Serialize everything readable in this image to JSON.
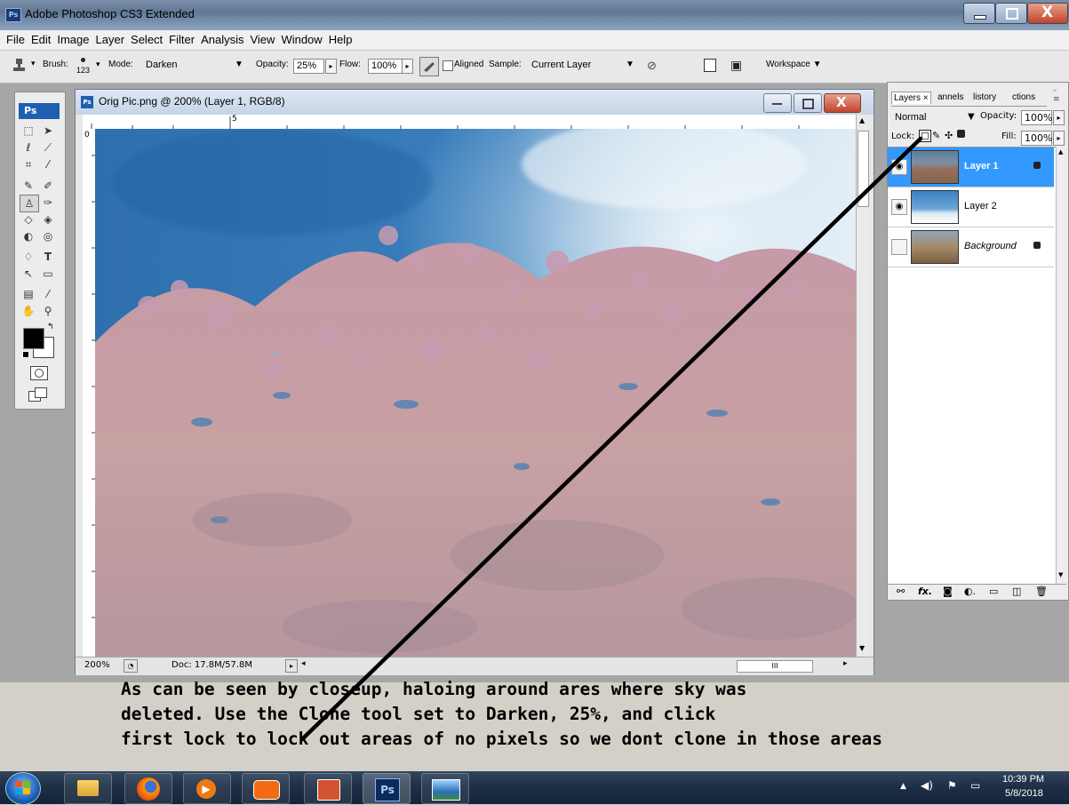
{
  "app": {
    "title": "Adobe Photoshop CS3 Extended",
    "badge": "Ps"
  },
  "menu": [
    "File",
    "Edit",
    "Image",
    "Layer",
    "Select",
    "Filter",
    "Analysis",
    "View",
    "Window",
    "Help"
  ],
  "options": {
    "brush_label": "Brush:",
    "brush_size": "123",
    "mode_label": "Mode:",
    "mode_value": "Darken",
    "opacity_label": "Opacity:",
    "opacity_value": "25%",
    "flow_label": "Flow:",
    "flow_value": "100%",
    "aligned_label": "Aligned",
    "sample_label": "Sample:",
    "sample_value": "Current Layer",
    "workspace_label": "Workspace"
  },
  "toolbox": {
    "logo": "Ps"
  },
  "document": {
    "title": "Orig Pic.png @ 200% (Layer 1, RGB/8)",
    "ruler_top_label": "5",
    "ruler_left_label": "0",
    "zoom": "200%",
    "doc_size": "Doc: 17.8M/57.8M",
    "scroll_marker": "III"
  },
  "layers_panel": {
    "tabs": [
      "Layers ×",
      "annels",
      "listory",
      "ctions"
    ],
    "blend_mode": "Normal",
    "opacity_label": "Opacity:",
    "opacity_value": "100%",
    "lock_label": "Lock:",
    "fill_label": "Fill:",
    "fill_value": "100%",
    "layers": [
      {
        "name": "Layer 1",
        "visible": true,
        "locked": true,
        "selected": true
      },
      {
        "name": "Layer 2",
        "visible": true,
        "locked": false,
        "selected": false
      },
      {
        "name": "Background",
        "visible": false,
        "locked": true,
        "selected": false
      }
    ],
    "footer_icons": [
      "link-icon",
      "fx-icon",
      "mask-icon",
      "adjustment-icon",
      "group-icon",
      "new-layer-icon",
      "trash-icon"
    ]
  },
  "annotation": {
    "line1": "As can be seen by closeup, haloing around ares where sky was",
    "line2": "deleted.  Use the Clone tool set to Darken, 25%,  and click",
    "line3": "first lock to lock out areas of no pixels so we dont clone in those areas"
  },
  "taskbar": {
    "time": "10:39 PM",
    "date": "5/8/2018",
    "ps_label": "Ps"
  },
  "colors": {
    "accent": "#3399ff",
    "sky": "#3f7fb8",
    "foliage": "#c9a2a6"
  }
}
